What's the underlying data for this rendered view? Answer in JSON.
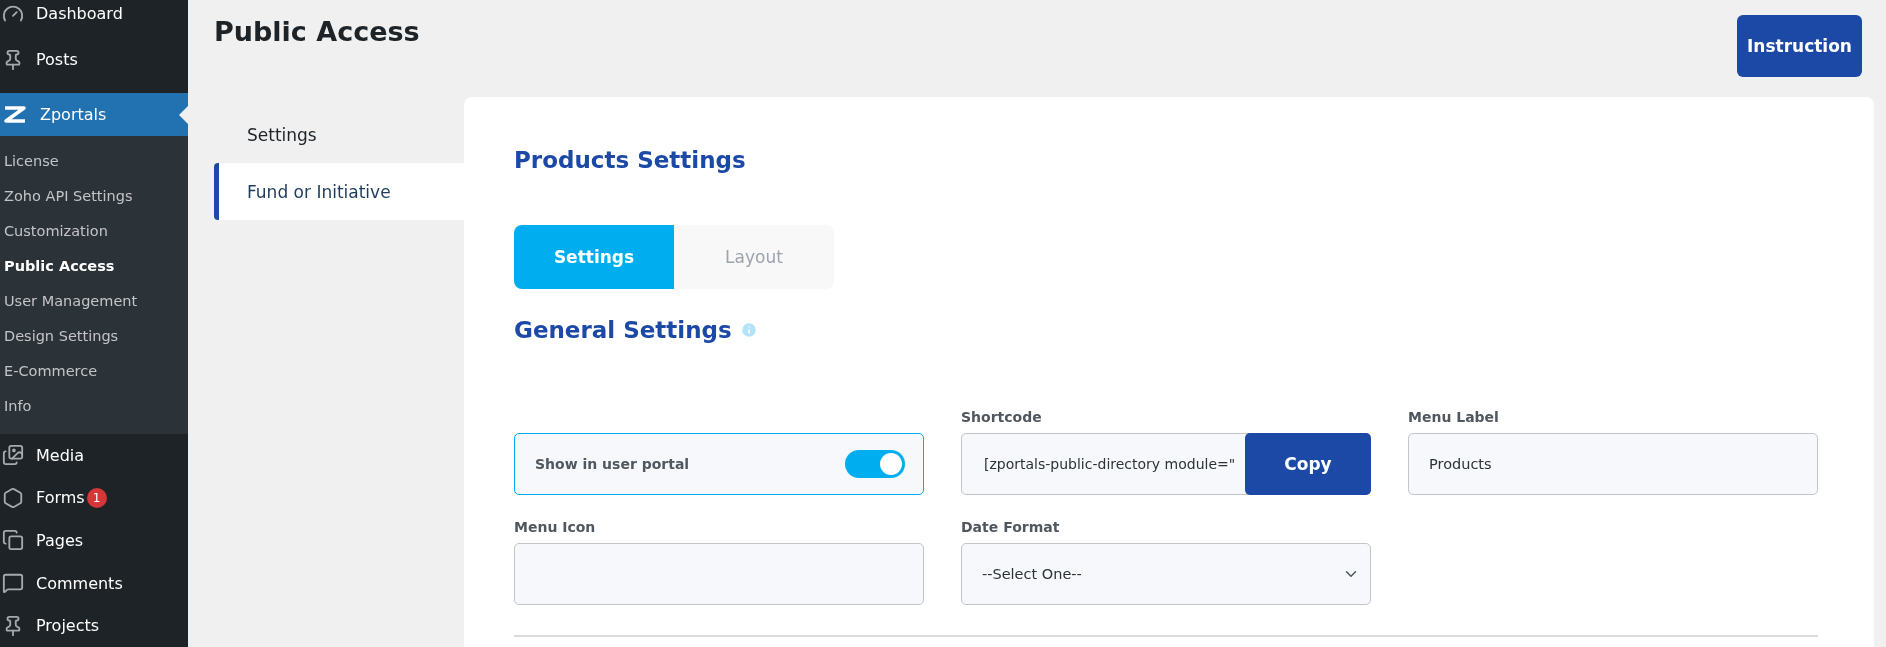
{
  "sidebar": {
    "items": [
      {
        "label": "Dashboard",
        "selected": false
      },
      {
        "label": "Posts",
        "selected": false
      },
      {
        "label": "Zportals",
        "selected": true,
        "children": [
          {
            "label": "License",
            "selected": false
          },
          {
            "label": "Zoho API Settings",
            "selected": false
          },
          {
            "label": "Customization",
            "selected": false
          },
          {
            "label": "Public Access",
            "selected": true
          },
          {
            "label": "User Management",
            "selected": false
          },
          {
            "label": "Design Settings",
            "selected": false
          },
          {
            "label": "E-Commerce",
            "selected": false
          },
          {
            "label": "Info",
            "selected": false
          }
        ]
      },
      {
        "label": "Media",
        "selected": false
      },
      {
        "label": "Forms",
        "selected": false,
        "badge": "1"
      },
      {
        "label": "Pages",
        "selected": false
      },
      {
        "label": "Comments",
        "selected": false
      },
      {
        "label": "Projects",
        "selected": false
      }
    ]
  },
  "page_title": "Public Access",
  "instruction_button": "Instruction",
  "section_tabs": [
    {
      "label": "Settings",
      "selected": false
    },
    {
      "label": "Fund or Initiative",
      "selected": true
    }
  ],
  "card": {
    "title": "Products Settings",
    "tabs": [
      {
        "label": "Settings",
        "selected": true
      },
      {
        "label": "Layout",
        "selected": false
      }
    ],
    "general_title": "General Settings",
    "fields": [
      {
        "kind": "toggle",
        "label": "Show in user portal",
        "on": true
      },
      {
        "kind": "shortcode",
        "label": "Shortcode",
        "value": "[zportals-public-directory module=\"",
        "button": "Copy"
      },
      {
        "kind": "text",
        "label": "Menu Label",
        "value": "Products"
      },
      {
        "kind": "text",
        "label": "Menu Icon"
      },
      {
        "kind": "select",
        "label": "Date Format",
        "value": "--Select One--"
      }
    ]
  }
}
